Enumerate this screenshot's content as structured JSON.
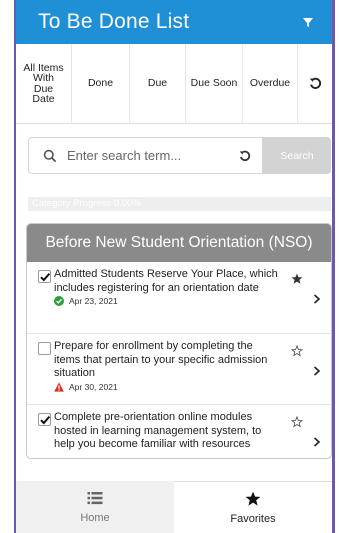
{
  "header": {
    "title": "To Be Done List",
    "filter_icon": "filter-icon"
  },
  "filters": {
    "all_label": "All Items With Due Date",
    "done_label": "Done",
    "due_label": "Due",
    "due_soon_label": "Due Soon",
    "overdue_label": "Overdue",
    "reset_icon": "reset-icon"
  },
  "search": {
    "placeholder": "Enter search term...",
    "button_label": "Search"
  },
  "progress": {
    "label": "Category Progress 0.00%",
    "percent": 0
  },
  "category": {
    "title": "Before New Student Orientation (NSO)",
    "items": [
      {
        "text": "Admitted Students Reserve Your Place, which includes registering for an orientation date",
        "checked": true,
        "favorite": true,
        "status": "done",
        "date": "Apr 23, 2021"
      },
      {
        "text": "Prepare for enrollment by completing the items that pertain to your specific admission situation",
        "checked": false,
        "favorite": false,
        "status": "overdue",
        "date": "Apr 30, 2021"
      },
      {
        "text": "Complete pre-orientation online modules hosted in learning management system, to help you become familiar with resources",
        "checked": true,
        "favorite": false,
        "status": "",
        "date": ""
      }
    ]
  },
  "tabbar": {
    "home_label": "Home",
    "favorites_label": "Favorites"
  },
  "colors": {
    "header_bg": "#1f8fd6",
    "category_header_bg": "#8a8a8a",
    "done_green": "#2e9e3e",
    "overdue_red": "#d93025"
  }
}
